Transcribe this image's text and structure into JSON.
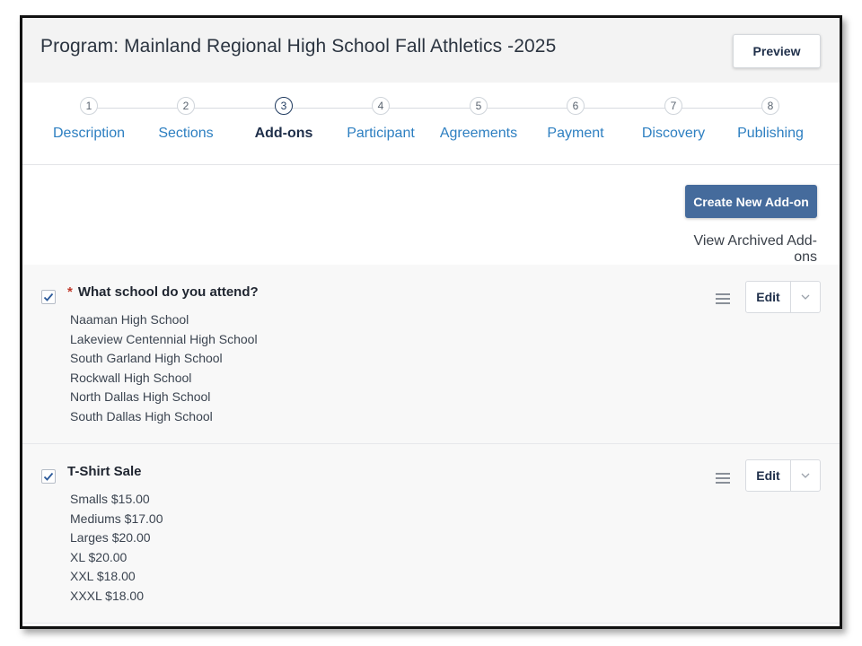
{
  "header": {
    "title": "Program: Mainland Regional High School Fall Athletics -2025",
    "preview_label": "Preview"
  },
  "steps": [
    {
      "num": "1",
      "label": "Description"
    },
    {
      "num": "2",
      "label": "Sections"
    },
    {
      "num": "3",
      "label": "Add-ons",
      "active": true
    },
    {
      "num": "4",
      "label": "Participant"
    },
    {
      "num": "5",
      "label": "Agreements"
    },
    {
      "num": "6",
      "label": "Payment"
    },
    {
      "num": "7",
      "label": "Discovery"
    },
    {
      "num": "8",
      "label": "Publishing"
    }
  ],
  "toolbar": {
    "create_label": "Create New Add-on",
    "archived_label": "View Archived Add-ons"
  },
  "addons": [
    {
      "required_mark": "*",
      "name": "What school do you attend?",
      "checked": true,
      "options": [
        "Naaman High School",
        "Lakeview Centennial High School",
        "South Garland High School",
        "Rockwall High School",
        "North Dallas High School",
        "South Dallas High School"
      ],
      "edit_label": "Edit"
    },
    {
      "name": "T-Shirt Sale",
      "checked": true,
      "options": [
        "Smalls $15.00",
        "Mediums $17.00",
        "Larges $20.00",
        "XL $20.00",
        "XXL $18.00",
        "XXXL $18.00"
      ],
      "edit_label": "Edit"
    }
  ],
  "colors": {
    "accent": "#456b9c",
    "link": "#2d7fc1",
    "required": "#c0392b",
    "header_bg": "#f3f3f3"
  }
}
